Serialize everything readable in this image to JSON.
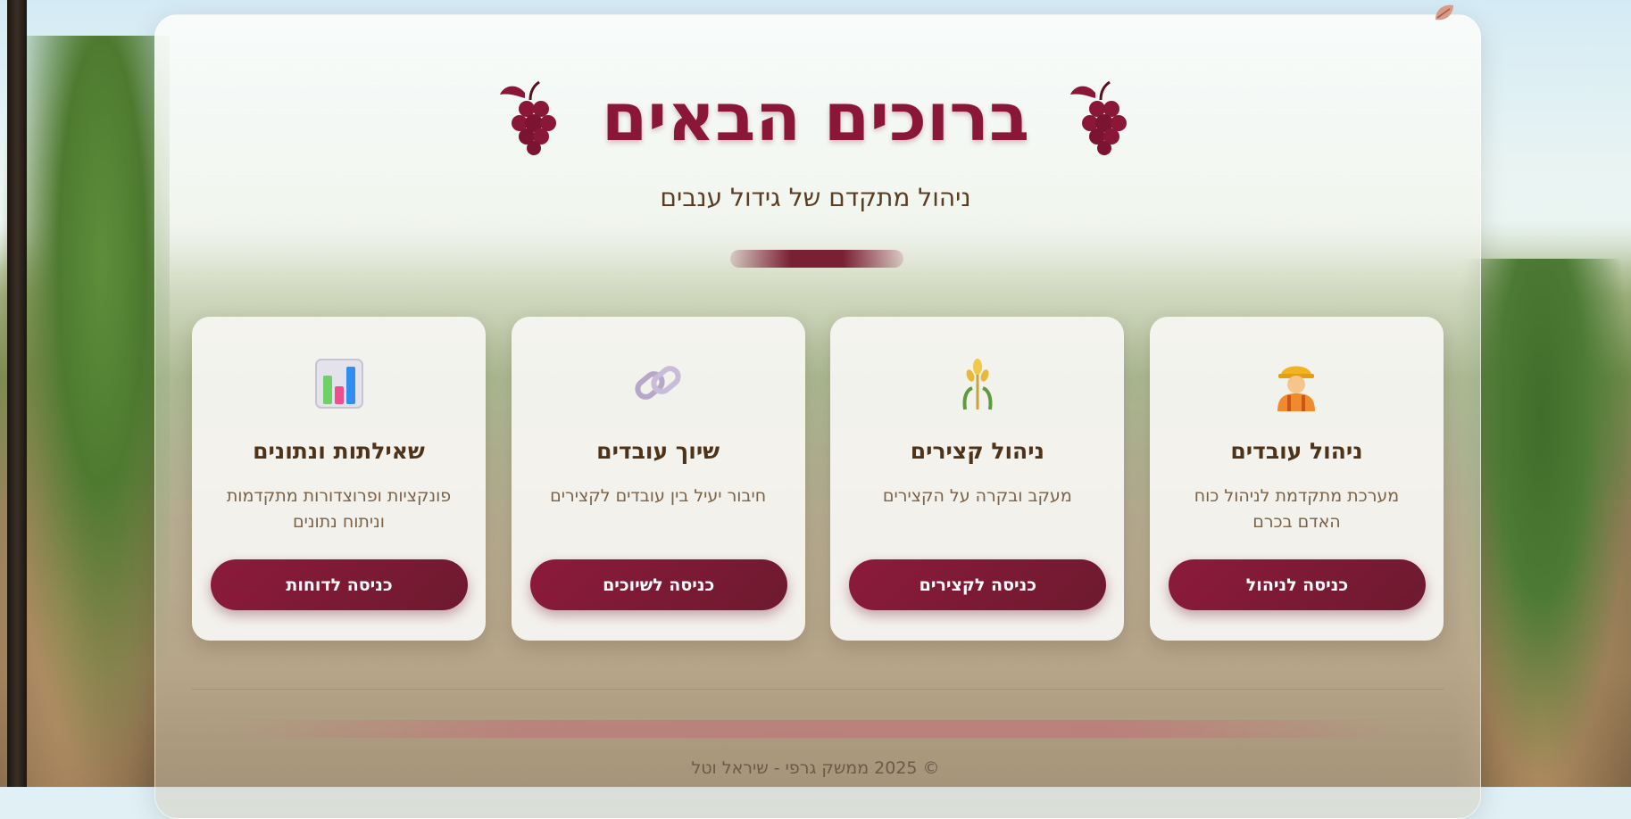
{
  "header": {
    "title": "ברוכים הבאים",
    "subtitle": "ניהול מתקדם של גידול ענבים",
    "title_icon": "grapes-icon"
  },
  "cards": [
    {
      "icon": "worker-icon",
      "title": "ניהול עובדים",
      "description": "מערכת מתקדמת לניהול כוח האדם בכרם",
      "button_label": "כניסה לניהול"
    },
    {
      "icon": "sheaf-icon",
      "title": "ניהול קצירים",
      "description": "מעקב ובקרה על הקצירים",
      "button_label": "כניסה לקצירים"
    },
    {
      "icon": "chain-link-icon",
      "title": "שיוך עובדים",
      "description": "חיבור יעיל בין עובדים לקצירים",
      "button_label": "כניסה לשיוכים"
    },
    {
      "icon": "bar-chart-icon",
      "title": "שאילתות ונתונים",
      "description": "פונקציות ופרוצדורות מתקדמות וניתוח נתונים",
      "button_label": "כניסה לדוחות"
    }
  ],
  "footer": {
    "copyright": "© 2025 ממשק גרפי - שיראל וטל"
  },
  "colors": {
    "accent": "#8a1738",
    "button": "#7a1a34",
    "title_text": "#4e3318",
    "body_text": "#7a6248"
  }
}
